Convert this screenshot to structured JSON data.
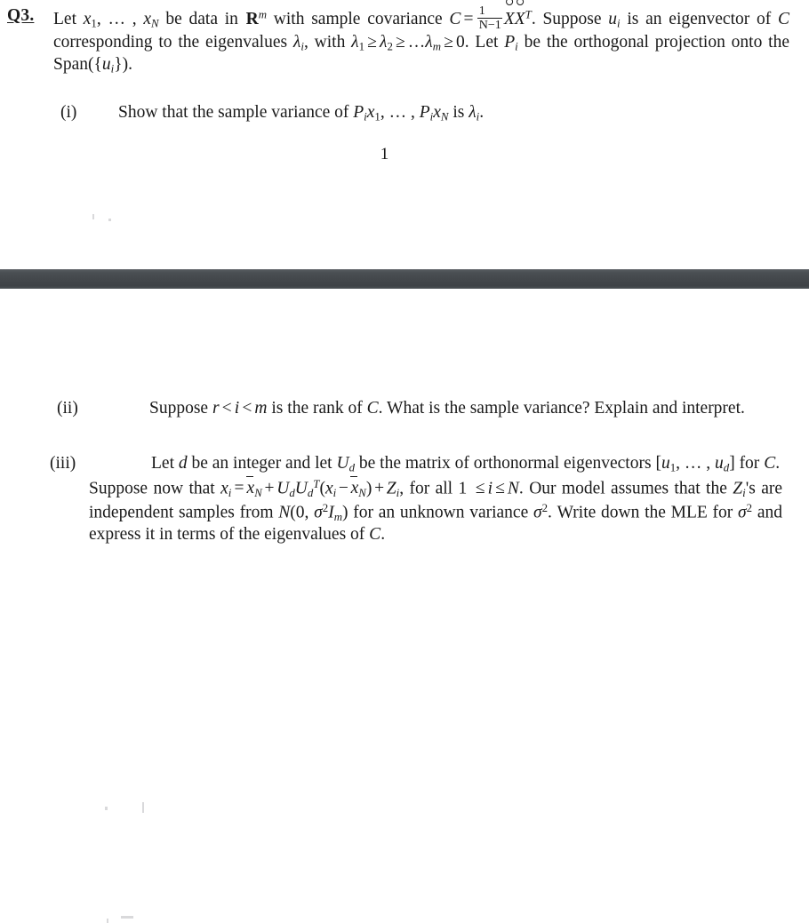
{
  "document": {
    "page_number": "1",
    "question_label": "Q3.",
    "divider_color": "#43474b",
    "background_color": "#ffffff",
    "text_color": "#1a1a1a"
  },
  "question": {
    "label": "Q3.",
    "line1_part1": "Let ",
    "line1_x1": "x",
    "line1_x1_sub": "1",
    "line1_dots": ", … , ",
    "line1_xN": "x",
    "line1_xN_sub": "N",
    "line1_part2": " be data in ",
    "line1_R": "R",
    "line1_R_sup": "m",
    "line1_part3": " with sample covariance ",
    "line1_C": "C",
    "line1_eq": "=",
    "frac_num": "1",
    "frac_den": "N−1",
    "line1_X1": "X",
    "line1_X2": "X",
    "line1_T": "T",
    "line1_part4": ". Suppose ",
    "line1_u": "u",
    "line1_u_sub": "i",
    "line1_part5": " is an eigenvector of ",
    "line2_C": "C",
    "line2_part1": " corresponding to the eigenvalues ",
    "line2_lambda": "λ",
    "line2_lambda_sub": "i",
    "line2_part2": ", with ",
    "line2_l1": "λ",
    "line2_l1_sub": "1",
    "line2_ge1": "≥",
    "line2_l2": "λ",
    "line2_l2_sub": "2",
    "line2_ge2": "≥",
    "line2_ldots": "…",
    "line2_lm": "λ",
    "line2_lm_sub": "m",
    "line2_ge3": "≥",
    "line2_zero": "0. Let ",
    "line3_P": "P",
    "line3_P_sub": "i",
    "line3_part1": " be the orthogonal projection onto the Span(",
    "line3_brace_open": "{",
    "line3_u": "u",
    "line3_u_sub": "i",
    "line3_brace_close": "}",
    "line3_part2": ")."
  },
  "items": [
    {
      "marker": "(i)",
      "text_part1": "Show that the sample variance of ",
      "P1": "P",
      "P1_sub": "i",
      "x1": "x",
      "x1_sub": "1",
      "dots": ", … , ",
      "P2": "P",
      "P2_sub": "i",
      "xN": "x",
      "xN_sub": "N",
      "text_part2": " is ",
      "lambda": "λ",
      "lambda_sub": "i",
      "text_part3": "."
    },
    {
      "marker": "(ii)",
      "text_part1": "Suppose ",
      "r": "r",
      "lt1": "<",
      "i": "i",
      "lt2": "<",
      "m": "m",
      "text_part2": " is the rank of ",
      "C": "C",
      "text_part3": ". What is the sample variance? Explain and interpret."
    },
    {
      "marker": "(iii)",
      "para1_part1": "Let ",
      "d": "d",
      "para1_part2": " be an integer and let ",
      "U": "U",
      "U_sub": "d",
      "para1_part3": " be the matrix of orthonormal eigenvectors ",
      "bracket_open": "[",
      "u1": "u",
      "u1_sub": "1",
      "u_dots": ", … , ",
      "ud": "u",
      "ud_sub": "d",
      "bracket_close": "]",
      "para1_part4": " for ",
      "C": "C",
      "para1_part5": ".",
      "para2_part1": "Suppose now that ",
      "xi": "x",
      "xi_sub": "i",
      "eq": "=",
      "xbar": "x",
      "xbar_sub": "N",
      "plus1": "+",
      "Ud": "U",
      "Ud_sub": "d",
      "UdT": "U",
      "UdT_sub": "d",
      "UdT_sup": "T",
      "paren_open": "(",
      "xi2": "x",
      "xi2_sub": "i",
      "minus": "−",
      "xbar2": "x",
      "xbar2_sub": "N",
      "paren_close": ")",
      "plus2": "+",
      "Z": "Z",
      "Z_sub": "i",
      "para2_part2": ", for all 1 ",
      "le1": "≤",
      "i2": "i",
      "le2": "≤",
      "N": "N",
      "para2_part3": ". Our model assumes that the ",
      "Zi": "Z",
      "Zi_sub": "i",
      "para2_part4": "'s are independent samples from ",
      "Ndist": "N",
      "Ndist_args_open": "(0, ",
      "sigma": "σ",
      "sigma_sup": "2",
      "Im": "I",
      "Im_sub": "m",
      "Ndist_args_close": ")",
      "para2_part5": " for an unknown variance ",
      "sigma2": "σ",
      "sigma2_sup": "2",
      "para2_part6": ". Write down the MLE for ",
      "sigma3": "σ",
      "sigma3_sup": "2",
      "para2_part7": " and express it in terms of the eigenvalues of ",
      "C2": "C",
      "para2_part8": "."
    }
  ]
}
